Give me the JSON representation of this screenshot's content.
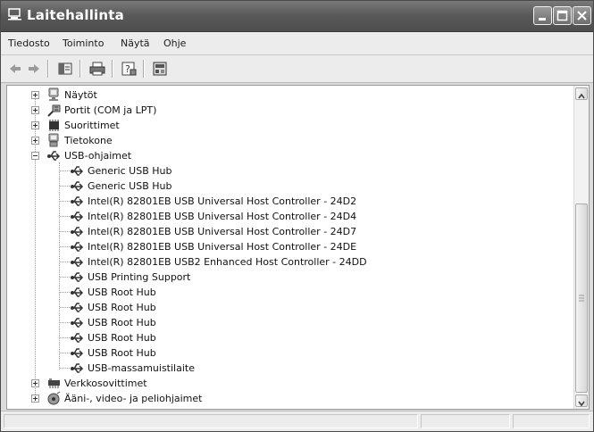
{
  "window": {
    "title": "Laitehallinta"
  },
  "menu": [
    "Tiedosto",
    "Toiminto",
    "Näytä",
    "Ohje"
  ],
  "toolbar": [
    "back-icon",
    "forward-icon",
    "console-tree-icon",
    "print-icon",
    "help-icon",
    "properties-icon"
  ],
  "tree": {
    "top_categories": [
      {
        "label": "Näytöt",
        "icon": "monitor-icon"
      },
      {
        "label": "Portit (COM ja LPT)",
        "icon": "port-icon"
      },
      {
        "label": "Suorittimet",
        "icon": "processor-icon"
      },
      {
        "label": "Tietokone",
        "icon": "computer-icon"
      }
    ],
    "expanded": {
      "label": "USB-ohjaimet",
      "icon": "usb-icon"
    },
    "usb_children": [
      "Generic USB Hub",
      "Generic USB Hub",
      "Intel(R) 82801EB USB Universal Host Controller - 24D2",
      "Intel(R) 82801EB USB Universal Host Controller - 24D4",
      "Intel(R) 82801EB USB Universal Host Controller - 24D7",
      "Intel(R) 82801EB USB Universal Host Controller - 24DE",
      "Intel(R) 82801EB USB2 Enhanced Host Controller - 24DD",
      "USB Printing Support",
      "USB Root Hub",
      "USB Root Hub",
      "USB Root Hub",
      "USB Root Hub",
      "USB Root Hub",
      "USB-massamuistilaite"
    ],
    "bottom_categories": [
      {
        "label": "Verkkosovittimet",
        "icon": "network-adapter-icon"
      },
      {
        "label": "Ääni-, video- ja peliohjaimet",
        "icon": "sound-icon"
      }
    ]
  }
}
